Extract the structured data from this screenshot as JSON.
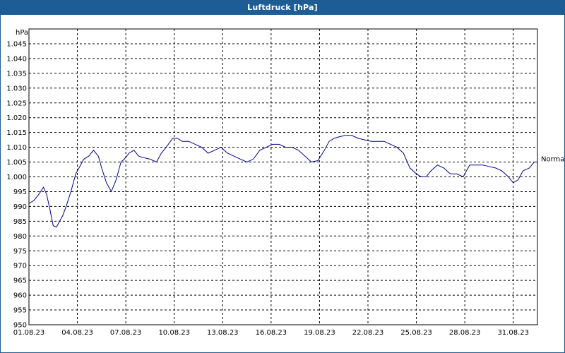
{
  "window": {
    "title": "Luftdruck [hPa]"
  },
  "chart_data": {
    "type": "line",
    "title": "Luftdruck [hPa]",
    "ylabel": "hPa",
    "xlabel": "",
    "ylim": [
      950,
      1050
    ],
    "y_ticks": [
      950,
      955,
      960,
      965,
      970,
      975,
      980,
      985,
      990,
      995,
      1000,
      1005,
      1010,
      1015,
      1020,
      1025,
      1030,
      1035,
      1040,
      1045
    ],
    "y_tick_labels": [
      "950",
      "955",
      "960",
      "965",
      "970",
      "975",
      "980",
      "985",
      "990",
      "995",
      "1.000",
      "1.005",
      "1.010",
      "1.015",
      "1.020",
      "1.025",
      "1.030",
      "1.035",
      "1.040",
      "1.045"
    ],
    "x_range_days": [
      1,
      32.5
    ],
    "x_ticks": [
      1,
      4,
      7,
      10,
      13,
      16,
      19,
      22,
      25,
      28,
      31
    ],
    "x_tick_labels": [
      "01.08.23",
      "04.08.23",
      "07.08.23",
      "10.08.23",
      "13.08.23",
      "16.08.23",
      "19.08.23",
      "22.08.23",
      "25.08.23",
      "28.08.23",
      "31.08.23"
    ],
    "grid": true,
    "line_color": "#00008b",
    "series": [
      {
        "name": "Normal",
        "x": [
          1.0,
          1.3,
          1.6,
          1.9,
          2.1,
          2.3,
          2.5,
          2.7,
          2.9,
          3.1,
          3.3,
          3.6,
          3.9,
          4.1,
          4.4,
          4.7,
          5.0,
          5.3,
          5.5,
          5.8,
          6.1,
          6.4,
          6.7,
          6.9,
          7.2,
          7.5,
          7.8,
          8.1,
          8.5,
          8.9,
          9.2,
          9.5,
          9.9,
          10.2,
          10.5,
          10.9,
          11.3,
          11.7,
          12.1,
          12.5,
          12.9,
          13.3,
          13.7,
          14.1,
          14.5,
          14.9,
          15.3,
          15.7,
          16.1,
          16.5,
          16.9,
          17.3,
          17.7,
          18.1,
          18.5,
          18.9,
          19.3,
          19.6,
          19.9,
          20.2,
          20.6,
          21.0,
          21.4,
          21.8,
          22.2,
          22.6,
          23.0,
          23.4,
          23.8,
          24.2,
          24.6,
          25.0,
          25.3,
          25.6,
          25.9,
          26.3,
          26.7,
          27.1,
          27.5,
          27.9,
          28.3,
          28.7,
          29.1,
          29.5,
          29.9,
          30.3,
          30.7,
          31.0,
          31.3,
          31.6,
          32.0,
          32.3,
          32.5
        ],
        "y": [
          991,
          992,
          994,
          996.5,
          994,
          989,
          983.5,
          983,
          985,
          987,
          990,
          995,
          1001,
          1003,
          1006,
          1007,
          1009,
          1007,
          1003,
          998,
          995,
          999,
          1005,
          1006,
          1008,
          1009,
          1007,
          1006.5,
          1006,
          1005,
          1008,
          1010,
          1013,
          1013,
          1012,
          1012,
          1011,
          1010,
          1008,
          1009,
          1010,
          1008,
          1007,
          1006,
          1005,
          1006,
          1009,
          1010,
          1011,
          1011,
          1010,
          1010,
          1009,
          1007,
          1005,
          1005.5,
          1009,
          1012,
          1013,
          1013.5,
          1014,
          1014,
          1013,
          1012.5,
          1012,
          1012,
          1012,
          1011,
          1010,
          1008,
          1003,
          1001,
          1000,
          1000,
          1002,
          1004,
          1003,
          1001,
          1001,
          1000,
          1004,
          1004,
          1004,
          1003.5,
          1003,
          1002,
          1000,
          998,
          999,
          1002,
          1003,
          1005,
          1005
        ]
      }
    ],
    "series_label": "Normal"
  }
}
